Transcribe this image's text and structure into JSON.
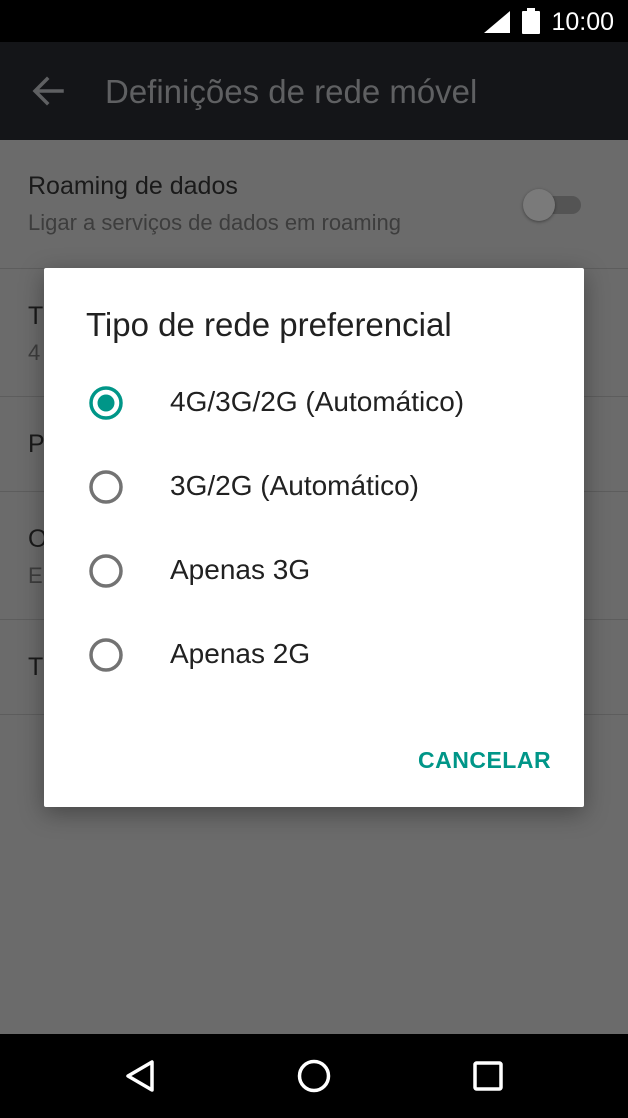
{
  "status_bar": {
    "time": "10:00"
  },
  "app_bar": {
    "title": "Definições de rede móvel"
  },
  "settings": {
    "roaming_title": "Roaming de dados",
    "roaming_subtitle": "Ligar a serviços de dados em roaming",
    "row2_title": "T",
    "row2_subtitle": "4",
    "row3_title": "P",
    "row4_title": "O",
    "row4_subtitle": "E",
    "row5_title": "T",
    "roaming_enabled": false
  },
  "dialog": {
    "title": "Tipo de rede preferencial",
    "options": [
      {
        "label": "4G/3G/2G (Automático)",
        "selected": true
      },
      {
        "label": "3G/2G (Automático)",
        "selected": false
      },
      {
        "label": "Apenas 3G",
        "selected": false
      },
      {
        "label": "Apenas 2G",
        "selected": false
      }
    ],
    "cancel_label": "CANCELAR"
  },
  "colors": {
    "accent": "#009688",
    "scrim_background": "#6b6b6b",
    "app_bar": "#141518"
  },
  "icons": {
    "back": "arrow-left-icon",
    "signal": "cell-signal-icon",
    "battery": "battery-icon",
    "nav_back": "triangle-back-icon",
    "nav_home": "circle-home-icon",
    "nav_recents": "square-recents-icon"
  }
}
